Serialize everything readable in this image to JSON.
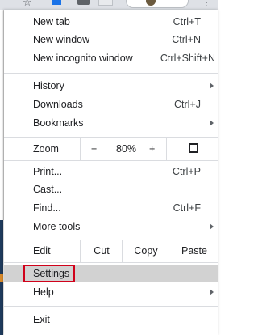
{
  "menu": {
    "new_tab": {
      "label": "New tab",
      "shortcut": "Ctrl+T"
    },
    "new_window": {
      "label": "New window",
      "shortcut": "Ctrl+N"
    },
    "new_incognito": {
      "label": "New incognito window",
      "shortcut": "Ctrl+Shift+N"
    },
    "history": {
      "label": "History"
    },
    "downloads": {
      "label": "Downloads",
      "shortcut": "Ctrl+J"
    },
    "bookmarks": {
      "label": "Bookmarks"
    },
    "zoom": {
      "label": "Zoom",
      "minus": "−",
      "level": "80%",
      "plus": "+"
    },
    "print": {
      "label": "Print...",
      "shortcut": "Ctrl+P"
    },
    "cast": {
      "label": "Cast..."
    },
    "find": {
      "label": "Find...",
      "shortcut": "Ctrl+F"
    },
    "more_tools": {
      "label": "More tools"
    },
    "edit": {
      "label": "Edit",
      "cut": "Cut",
      "copy": "Copy",
      "paste": "Paste"
    },
    "settings": {
      "label": "Settings",
      "highlight_color": "#d0021b"
    },
    "help": {
      "label": "Help"
    },
    "exit": {
      "label": "Exit"
    }
  }
}
